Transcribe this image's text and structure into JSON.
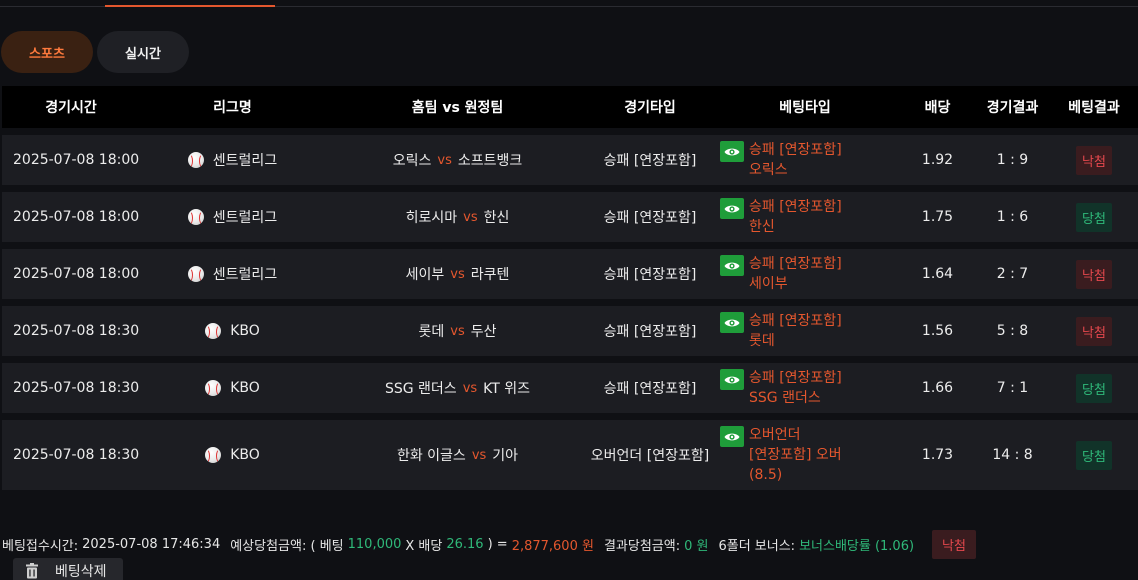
{
  "tabs": [
    {
      "label": "스포츠",
      "active": true
    },
    {
      "label": "실시간",
      "active": false
    }
  ],
  "table": {
    "headers": [
      "경기시간",
      "리그명",
      "홈팀 vs 원정팀",
      "경기타입",
      "베팅타입",
      "배당",
      "경기결과",
      "베팅결과"
    ],
    "vs_label": "vs",
    "rows": [
      {
        "time": "2025-07-08 18:00",
        "league": "센트럴리그",
        "home": "오릭스",
        "away": "소프트뱅크",
        "game_type": "승패 [연장포함]",
        "bet_type_lines": [
          "승패 [연장포함]",
          "오릭스"
        ],
        "odds": "1.92",
        "score": "1 : 9",
        "bet_result": "낙첨",
        "result_kind": "lose"
      },
      {
        "time": "2025-07-08 18:00",
        "league": "센트럴리그",
        "home": "히로시마",
        "away": "한신",
        "game_type": "승패 [연장포함]",
        "bet_type_lines": [
          "승패 [연장포함]",
          "한신"
        ],
        "odds": "1.75",
        "score": "1 : 6",
        "bet_result": "당첨",
        "result_kind": "win"
      },
      {
        "time": "2025-07-08 18:00",
        "league": "센트럴리그",
        "home": "세이부",
        "away": "라쿠텐",
        "game_type": "승패 [연장포함]",
        "bet_type_lines": [
          "승패 [연장포함]",
          "세이부"
        ],
        "odds": "1.64",
        "score": "2 : 7",
        "bet_result": "낙첨",
        "result_kind": "lose"
      },
      {
        "time": "2025-07-08 18:30",
        "league": "KBO",
        "home": "롯데",
        "away": "두산",
        "game_type": "승패 [연장포함]",
        "bet_type_lines": [
          "승패 [연장포함]",
          "롯데"
        ],
        "odds": "1.56",
        "score": "5 : 8",
        "bet_result": "낙첨",
        "result_kind": "lose"
      },
      {
        "time": "2025-07-08 18:30",
        "league": "KBO",
        "home": "SSG 랜더스",
        "away": "KT 위즈",
        "game_type": "승패 [연장포함]",
        "bet_type_lines": [
          "승패 [연장포함]",
          "SSG 랜더스"
        ],
        "odds": "1.66",
        "score": "7 : 1",
        "bet_result": "당첨",
        "result_kind": "win"
      },
      {
        "time": "2025-07-08 18:30",
        "league": "KBO",
        "home": "한화 이글스",
        "away": "기아",
        "game_type": "오버언더 [연장포함]",
        "bet_type_lines": [
          "오버언더",
          "[연장포함] 오버",
          "(8.5)"
        ],
        "odds": "1.73",
        "score": "14 : 8",
        "bet_result": "당첨",
        "result_kind": "win"
      }
    ]
  },
  "footer": {
    "bet_time_label": "베팅접수시간:",
    "bet_time": "2025-07-08 17:46:34",
    "expected_label": "예상당첨금액: ( 베팅",
    "stake": "110,000",
    "times_label": "X 배당",
    "total_odds": "26.16",
    "close_eq": ") =",
    "expected_amount": "2,877,600 원",
    "result_label": "결과당첨금액:",
    "result_amount": "0 원",
    "bonus_label": "6폴더 보너스:",
    "bonus_value": "보너스배당률 (1.06)",
    "status": "낙첨"
  },
  "delete_button": {
    "label": "베팅삭제"
  },
  "colors": {
    "accent": "#e4572e",
    "win": "#2fb879",
    "lose": "#e5484d",
    "eye_bg": "#1f9d3a"
  }
}
